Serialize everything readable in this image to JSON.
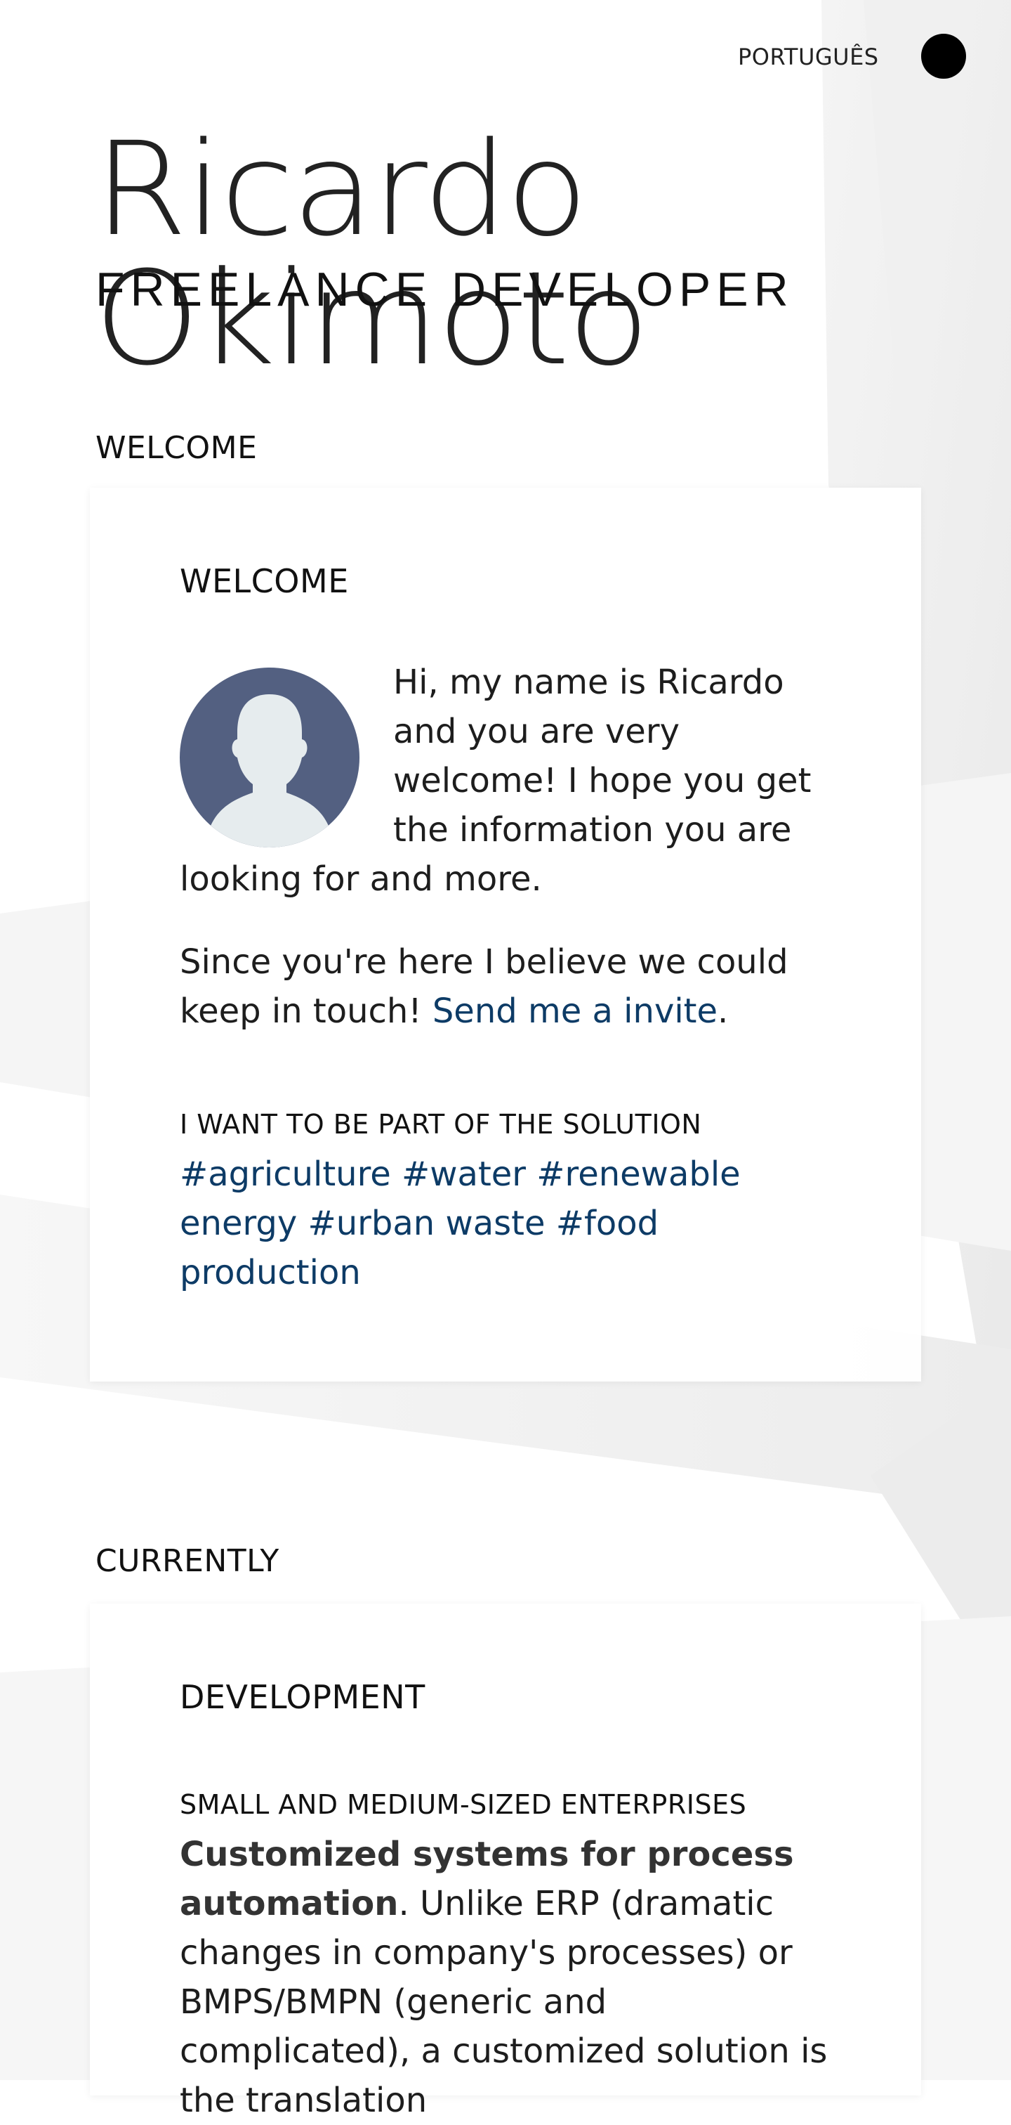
{
  "header": {
    "language_link": "PORTUGUÊS"
  },
  "hero": {
    "name": "Ricardo Okimoto",
    "subtitle": "FREELANCE DEVELOPER"
  },
  "welcome_section": {
    "label": "WELCOME",
    "card_title": "WELCOME",
    "intro": "Hi, my name is Ricardo and you are very welcome! I hope you get the information you are looking for and more.",
    "invite_text": "Since you're here I believe we could keep in touch! ",
    "invite_link": "Send me a invite",
    "invite_end": ".",
    "solution_heading": "I WANT TO BE PART OF THE SOLUTION",
    "tags": [
      "#agriculture",
      "#water",
      "#renewable energy",
      "#urban waste",
      "#food production"
    ]
  },
  "currently_section": {
    "label": "CURRENTLY",
    "card_title": "DEVELOPMENT",
    "subheading": "SMALL AND MEDIUM-SIZED ENTERPRISES",
    "bold_text": "Customized systems for process automation",
    "body_text": ". Unlike ERP (dramatic changes in company's processes) or BMPS/BMPN (generic and complicated), a customized solution is the translation"
  },
  "colors": {
    "link": "#0d3b66",
    "avatar_bg": "#536081",
    "avatar_figure": "#e6ecee"
  }
}
